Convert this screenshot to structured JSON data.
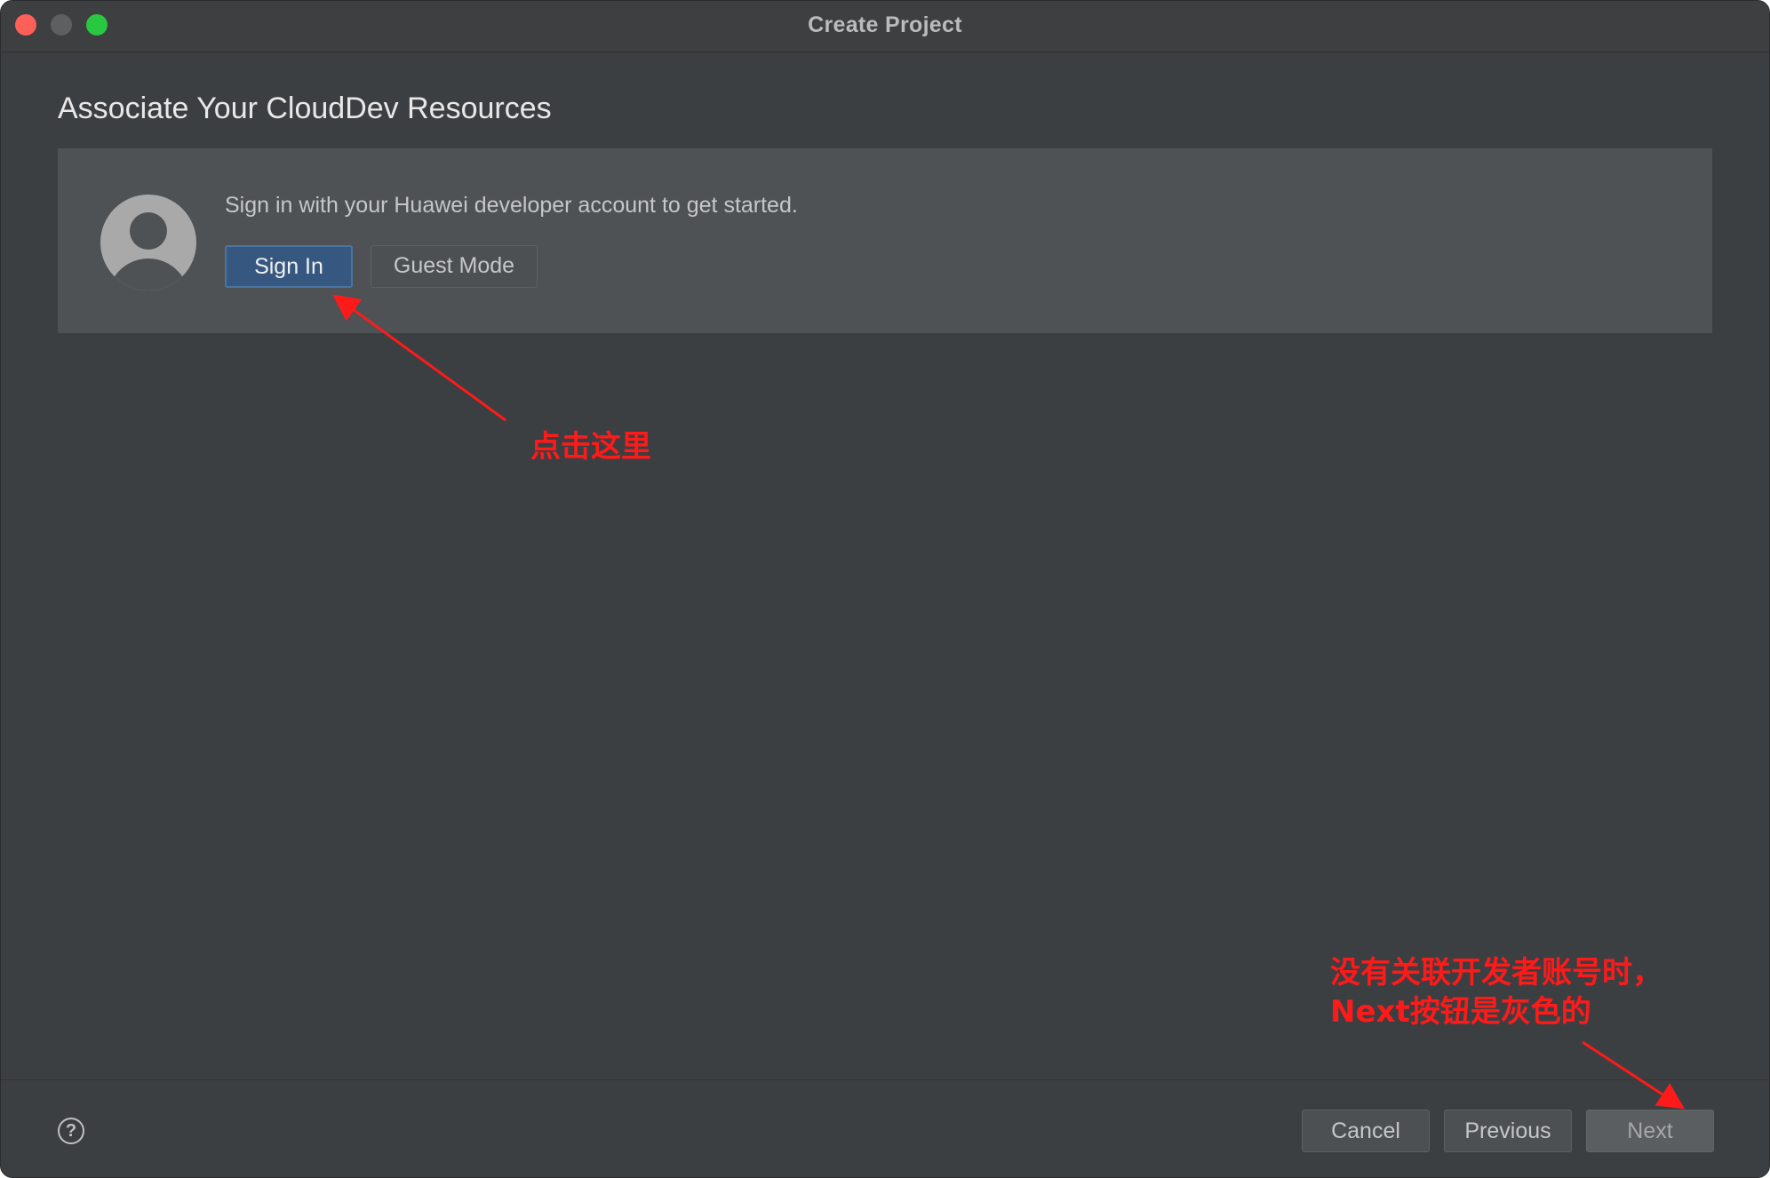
{
  "window": {
    "title": "Create Project"
  },
  "page": {
    "heading": "Associate Your CloudDev Resources"
  },
  "account_panel": {
    "message": "Sign in with your Huawei developer account to get started.",
    "sign_in_label": "Sign In",
    "guest_mode_label": "Guest Mode"
  },
  "footer": {
    "help_symbol": "?",
    "cancel_label": "Cancel",
    "previous_label": "Previous",
    "next_label": "Next"
  },
  "annotations": {
    "click_here": "点击这里",
    "next_gray_line1": "没有关联开发者账号时，",
    "next_gray_line2": "Next按钮是灰色的"
  },
  "colors": {
    "window_bg": "#3c3f41",
    "panel_bg": "#4e5254",
    "primary_button": "#365880",
    "annotation_red": "#ff1a1a"
  }
}
